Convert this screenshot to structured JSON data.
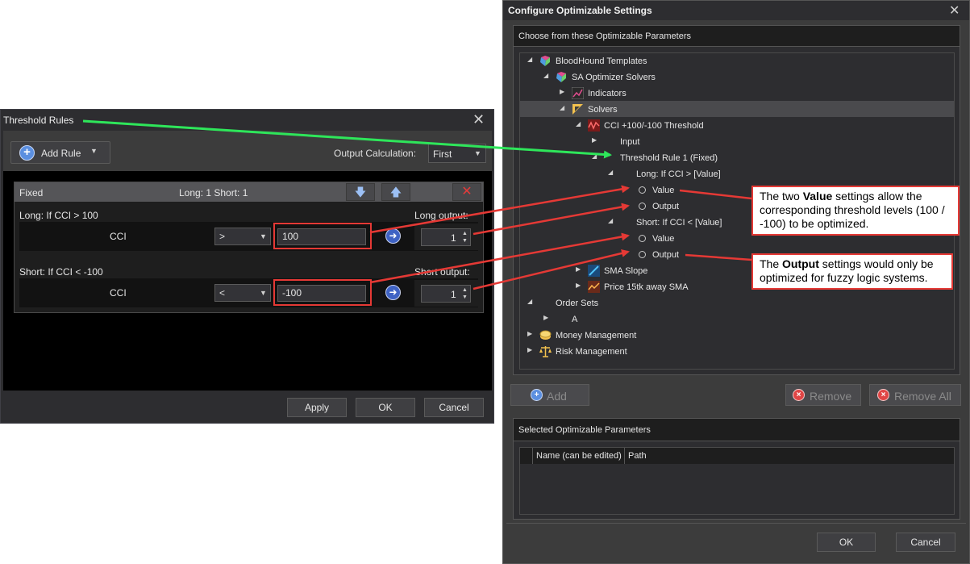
{
  "threshold_window": {
    "title": "Threshold Rules",
    "add_rule_label": "Add Rule",
    "output_calc_label": "Output Calculation:",
    "output_calc_value": "First",
    "rule": {
      "type": "Fixed",
      "summary": "Long: 1 Short: 1",
      "long": {
        "label": "Long: If CCI > 100",
        "indicator": "CCI",
        "operator": ">",
        "threshold": "100",
        "output_label": "Long output:",
        "output_value": "1"
      },
      "short": {
        "label": "Short: If CCI < -100",
        "indicator": "CCI",
        "operator": "<",
        "threshold": "-100",
        "output_label": "Short output:",
        "output_value": "1"
      }
    },
    "buttons": {
      "apply": "Apply",
      "ok": "OK",
      "cancel": "Cancel"
    }
  },
  "config_window": {
    "title": "Configure Optimizable Settings",
    "choose_header": "Choose from these Optimizable Parameters",
    "tree": [
      {
        "label": "BloodHound Templates",
        "arrow": "expanded",
        "icon": "bloodhound-icon"
      },
      {
        "label": "SA Optimizer Solvers",
        "arrow": "expanded",
        "icon": "solver-group-icon"
      },
      {
        "label": "Indicators",
        "arrow": "collapsed",
        "icon": "indicators-icon"
      },
      {
        "label": "Solvers",
        "arrow": "expanded",
        "icon": "solvers-icon"
      },
      {
        "label": "CCI +100/-100 Threshold",
        "arrow": "expanded",
        "icon": "cci-threshold-icon"
      },
      {
        "label": "Input",
        "arrow": "collapsed"
      },
      {
        "label": "Threshold Rule 1 (Fixed)",
        "arrow": "expanded"
      },
      {
        "label": "Long: If CCI > [Value]",
        "arrow": "expanded"
      },
      {
        "label": "Value",
        "radio": true
      },
      {
        "label": "Output",
        "radio": true
      },
      {
        "label": "Short: If CCI < [Value]",
        "arrow": "expanded"
      },
      {
        "label": "Value",
        "radio": true
      },
      {
        "label": "Output",
        "radio": true
      },
      {
        "label": "SMA Slope",
        "arrow": "collapsed",
        "icon": "sma-slope-icon"
      },
      {
        "label": "Price 15tk away SMA",
        "arrow": "collapsed",
        "icon": "price-sma-icon"
      },
      {
        "label": "Order Sets",
        "arrow": "expanded"
      },
      {
        "label": "A",
        "arrow": "collapsed"
      },
      {
        "label": "Money Management",
        "arrow": "collapsed",
        "icon": "money-icon"
      },
      {
        "label": "Risk Management",
        "arrow": "collapsed",
        "icon": "scales-icon"
      }
    ],
    "add_label": "Add",
    "remove_label": "Remove",
    "remove_all_label": "Remove All",
    "selected_header": "Selected Optimizable Parameters",
    "columns": [
      "Name (can be edited)",
      "Path"
    ],
    "buttons": {
      "ok": "OK",
      "cancel": "Cancel"
    }
  },
  "annotations": {
    "callout_value": {
      "pre": "The two ",
      "bold": "Value",
      "post": " settings allow the corresponding threshold levels (100 / -100) to be optimized."
    },
    "callout_output": {
      "pre": "The ",
      "bold": "Output",
      "post": " settings would only be optimized for fuzzy logic systems."
    }
  },
  "colors": {
    "annotation_red": "#e53935",
    "annotation_green": "#2ee65a",
    "dark_bg": "#2d2d30"
  }
}
